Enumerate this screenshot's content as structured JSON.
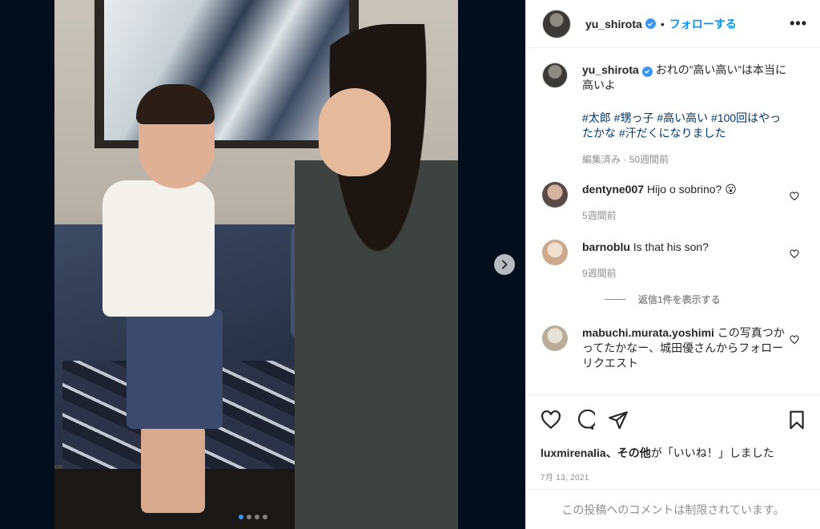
{
  "post": {
    "username": "yu_shirota",
    "separator": "•",
    "follow_label": "フォローする",
    "more_label": "•••",
    "carousel": {
      "image_count": 4,
      "current_index": 1
    }
  },
  "caption": {
    "username": "yu_shirota",
    "text": "おれの”高い高い”は本当に高いよ",
    "hashtags": "#太郎 #甥っ子 #高い高い #100回はやったかな #汗だくになりました",
    "meta": "編集済み · 50週間前"
  },
  "comments": [
    {
      "username": "dentyne007",
      "text": "Hijo o sobrino? 😮",
      "time": "5週間前"
    },
    {
      "username": "barnoblu",
      "text": "Is that his son?",
      "time": "9週間前",
      "replies_label": "返信1件を表示する"
    },
    {
      "username": "mabuchi.murata.yoshimi",
      "text": "この写真つかってたかなー、城田優さんからフォローリクエスト"
    }
  ],
  "actions": {
    "likes_user": "luxmirenalia",
    "likes_suffix_bold": "、その他",
    "likes_tail": "が「いいね！」しました",
    "date": "7月 13, 2021",
    "restricted_text": "この投稿へのコメントは制限されています。"
  },
  "colors": {
    "accent": "#0095f6",
    "verified": "#3897f0",
    "hashtag": "#00376b"
  }
}
